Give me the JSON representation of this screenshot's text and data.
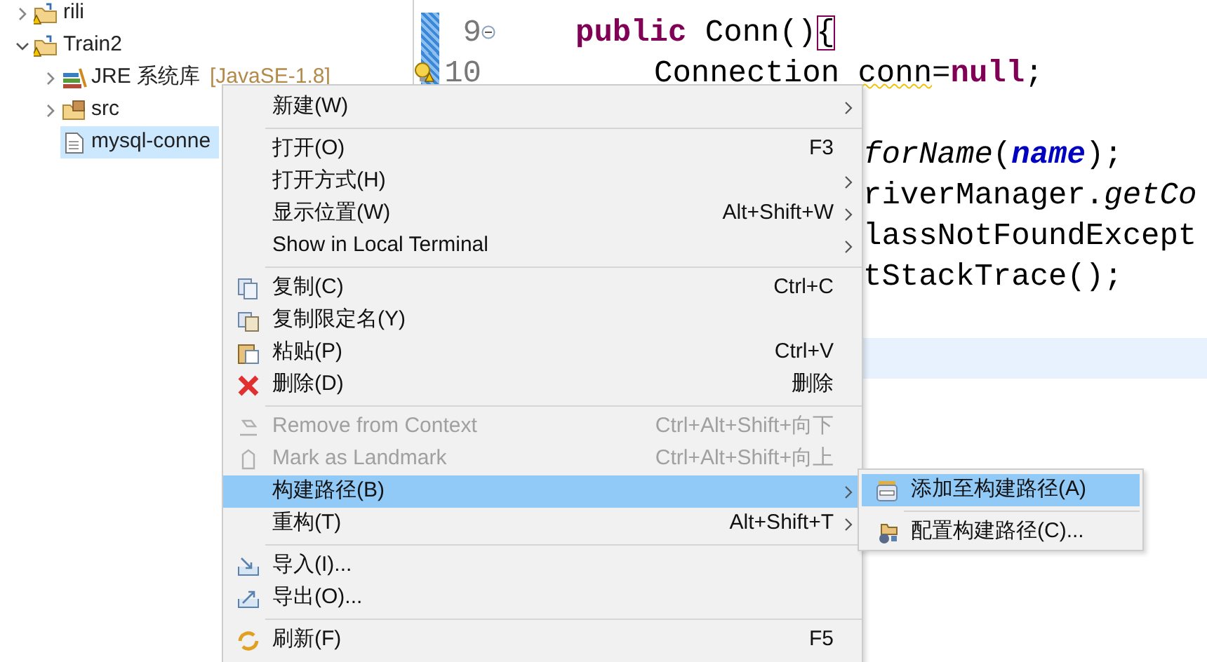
{
  "explorer": {
    "items": [
      {
        "kind": "project",
        "label": "rili",
        "expanded": false,
        "selected": false
      },
      {
        "kind": "project",
        "label": "Train2",
        "expanded": true,
        "selected": false,
        "children": [
          {
            "kind": "library",
            "label": "JRE 系统库",
            "decoration": "[JavaSE-1.8]",
            "expanded": false,
            "selected": false
          },
          {
            "kind": "package",
            "label": "src",
            "expanded": false,
            "selected": false
          },
          {
            "kind": "file",
            "label": "mysql-conne",
            "selected": true
          }
        ]
      }
    ]
  },
  "editor": {
    "lines": [
      {
        "kind": "member",
        "number": "9",
        "folding": true,
        "changed": true,
        "current": false,
        "segments": [
          {
            "kind": "keyword",
            "text": "public"
          },
          {
            "kind": "plain",
            "text": " Conn()"
          },
          {
            "kind": "bracket",
            "text": "{"
          }
        ]
      },
      {
        "kind": "statement",
        "number": "10",
        "warning": true,
        "changed": true,
        "current": false,
        "segments": [
          {
            "kind": "plain",
            "text": "Connection "
          },
          {
            "kind": "warned",
            "text": "conn"
          },
          {
            "kind": "plain",
            "text": "="
          },
          {
            "kind": "keyword",
            "text": "null"
          },
          {
            "kind": "plain",
            "text": ";"
          }
        ]
      },
      {
        "kind": "blank",
        "current": false
      },
      {
        "kind": "fragment",
        "current": false,
        "segments": [
          {
            "kind": "italic",
            "text": "forName"
          },
          {
            "kind": "plain",
            "text": "("
          },
          {
            "kind": "field",
            "text": "name"
          },
          {
            "kind": "plain",
            "text": ");"
          }
        ]
      },
      {
        "kind": "fragment",
        "current": false,
        "segments": [
          {
            "kind": "plain",
            "text": "riverManager."
          },
          {
            "kind": "italic",
            "text": "getCo"
          }
        ]
      },
      {
        "kind": "fragment",
        "current": false,
        "segments": [
          {
            "kind": "plain",
            "text": "lassNotFoundExcept"
          }
        ]
      },
      {
        "kind": "fragment",
        "current": false,
        "segments": [
          {
            "kind": "plain",
            "text": "tStackTrace();"
          }
        ]
      },
      {
        "kind": "blank",
        "current": false
      },
      {
        "kind": "blank",
        "current": true
      }
    ]
  },
  "context_menu": {
    "items": [
      {
        "kind": "item",
        "label": "新建(W)",
        "submenu": true,
        "disabled": false,
        "selected": false
      },
      {
        "kind": "separator"
      },
      {
        "kind": "item",
        "label": "打开(O)",
        "shortcut": "F3",
        "submenu": false,
        "disabled": false,
        "selected": false
      },
      {
        "kind": "item",
        "label": "打开方式(H)",
        "submenu": true,
        "disabled": false,
        "selected": false
      },
      {
        "kind": "item",
        "label": "显示位置(W)",
        "shortcut": "Alt+Shift+W",
        "submenu": true,
        "disabled": false,
        "selected": false
      },
      {
        "kind": "item",
        "label": "Show in Local Terminal",
        "submenu": true,
        "disabled": false,
        "selected": false
      },
      {
        "kind": "separator"
      },
      {
        "kind": "item",
        "label": "复制(C)",
        "shortcut": "Ctrl+C",
        "submenu": false,
        "disabled": false,
        "selected": false
      },
      {
        "kind": "item",
        "label": "复制限定名(Y)",
        "submenu": false,
        "disabled": false,
        "selected": false
      },
      {
        "kind": "item",
        "label": "粘贴(P)",
        "shortcut": "Ctrl+V",
        "submenu": false,
        "disabled": false,
        "selected": false
      },
      {
        "kind": "item",
        "label": "删除(D)",
        "shortcut": "删除",
        "submenu": false,
        "disabled": false,
        "selected": false
      },
      {
        "kind": "separator"
      },
      {
        "kind": "item",
        "label": "Remove from Context",
        "shortcut": "Ctrl+Alt+Shift+向下",
        "submenu": false,
        "disabled": true,
        "selected": false
      },
      {
        "kind": "item",
        "label": "Mark as Landmark",
        "shortcut": "Ctrl+Alt+Shift+向上",
        "submenu": false,
        "disabled": true,
        "selected": false
      },
      {
        "kind": "item",
        "label": "构建路径(B)",
        "submenu": true,
        "disabled": false,
        "selected": true
      },
      {
        "kind": "item",
        "label": "重构(T)",
        "shortcut": "Alt+Shift+T",
        "submenu": true,
        "disabled": false,
        "selected": false
      },
      {
        "kind": "separator"
      },
      {
        "kind": "item",
        "label": "导入(I)...",
        "submenu": false,
        "disabled": false,
        "selected": false
      },
      {
        "kind": "item",
        "label": "导出(O)...",
        "submenu": false,
        "disabled": false,
        "selected": false
      },
      {
        "kind": "separator"
      },
      {
        "kind": "item",
        "label": "刷新(F)",
        "shortcut": "F5",
        "submenu": false,
        "disabled": false,
        "selected": false
      }
    ]
  },
  "build_path_submenu": {
    "items": [
      {
        "kind": "item",
        "label": "添加至构建路径(A)",
        "selected": true
      },
      {
        "kind": "separator"
      },
      {
        "kind": "item",
        "label": "配置构建路径(C)...",
        "selected": false
      }
    ]
  }
}
